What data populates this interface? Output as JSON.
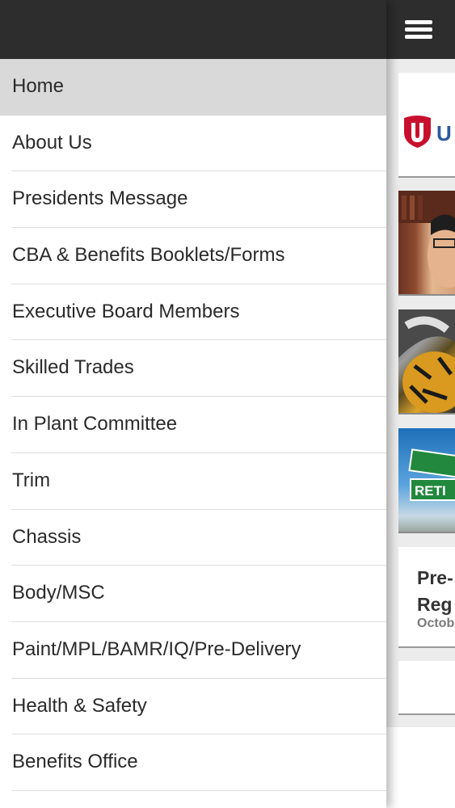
{
  "header": {
    "menu_icon": "hamburger-menu-icon"
  },
  "drawer": {
    "items": [
      {
        "label": "Home",
        "active": true
      },
      {
        "label": "About Us"
      },
      {
        "label": "Presidents Message"
      },
      {
        "label": "CBA & Benefits Booklets/Forms"
      },
      {
        "label": "Executive Board Members"
      },
      {
        "label": "Skilled Trades"
      },
      {
        "label": "In Plant Committee"
      },
      {
        "label": "Trim"
      },
      {
        "label": "Chassis"
      },
      {
        "label": "Body/MSC"
      },
      {
        "label": "Paint/MPL/BAMR/IQ/Pre-Delivery"
      },
      {
        "label": "Health & Safety"
      },
      {
        "label": "Benefits Office"
      }
    ]
  },
  "main": {
    "logo_text": "U",
    "thumb3_sign_text": "RETI",
    "article": {
      "title": "Pre-\nReg",
      "date": "Octob"
    }
  },
  "colors": {
    "header_bg": "#2e2d2e",
    "active_item_bg": "#d9d9d9",
    "logo_red": "#c8102e",
    "logo_blue": "#2c5aa0"
  }
}
